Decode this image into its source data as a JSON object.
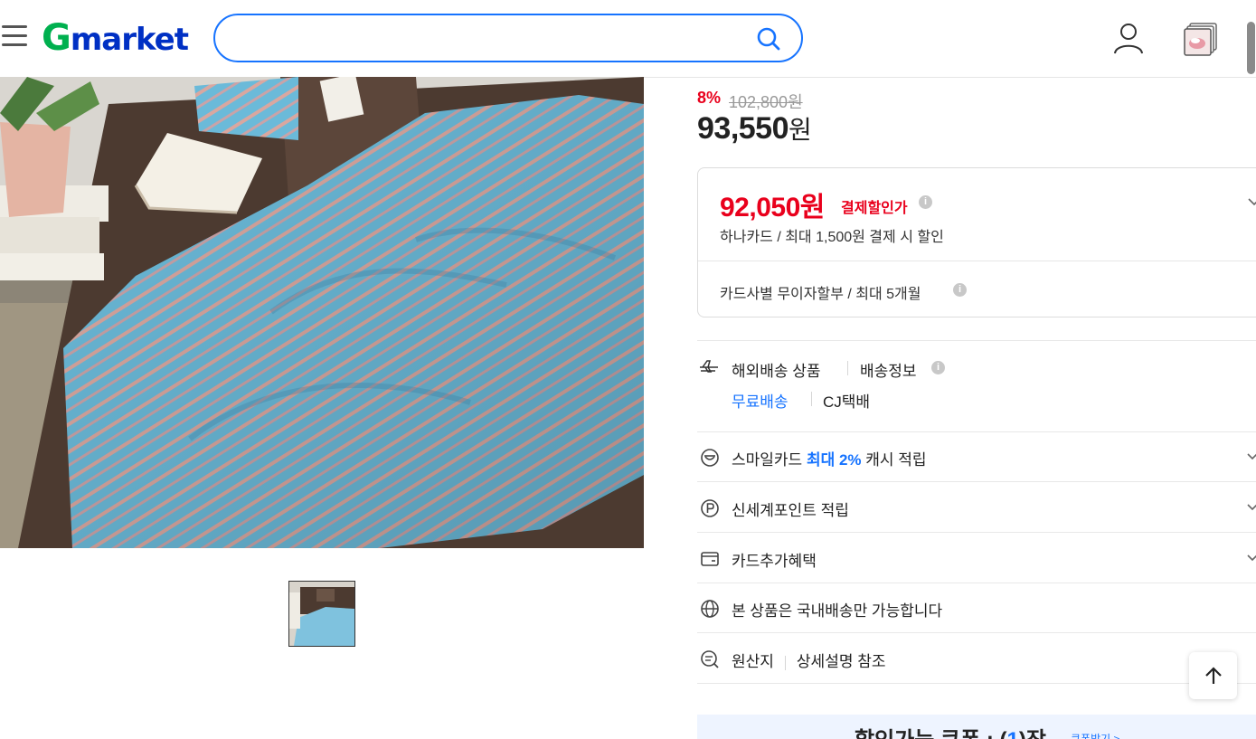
{
  "header": {
    "logo_g": "G",
    "logo_rest": "market",
    "search_placeholder": "",
    "brand_colors": {
      "logo_blue": "#0030c4",
      "logo_green": "#00b04f",
      "search_border": "#1673ff"
    }
  },
  "product": {
    "discount_rate": "8%",
    "original_price": "102,800원",
    "price_num": "93,550",
    "price_unit": "원"
  },
  "card_discount": {
    "sale_price": "92,050원",
    "sale_label": "결제할인가",
    "hana_text": "하나카드 / 최대 1,500원 결제 시 할인",
    "installment_text": "카드사별 무이자할부 / 최대 5개월"
  },
  "shipping": {
    "overseas": "해외배송 상품",
    "info": "배송정보",
    "free": "무료배송",
    "carrier": "CJ택배"
  },
  "benefits": [
    {
      "icon": "smile-card-icon",
      "pre": "스마일카드 ",
      "highlight": "최대 2%",
      "post": " 캐시 적립"
    },
    {
      "icon": "point-icon",
      "text": "신세계포인트 적립"
    },
    {
      "icon": "card-icon",
      "text": "카드추가혜택"
    },
    {
      "icon": "globe-icon",
      "text": "본 상품은 국내배송만 가능합니다"
    },
    {
      "icon": "origin-search-icon",
      "label": "원산지",
      "value": "상세설명 참조"
    }
  ],
  "coupon": {
    "pre": "할인가능 쿠폰 : (",
    "count": "1",
    "post": ")장",
    "link": "쿠폰받기 >"
  },
  "colors": {
    "sale_red": "#e9001c",
    "accent_blue": "#1673ff"
  }
}
